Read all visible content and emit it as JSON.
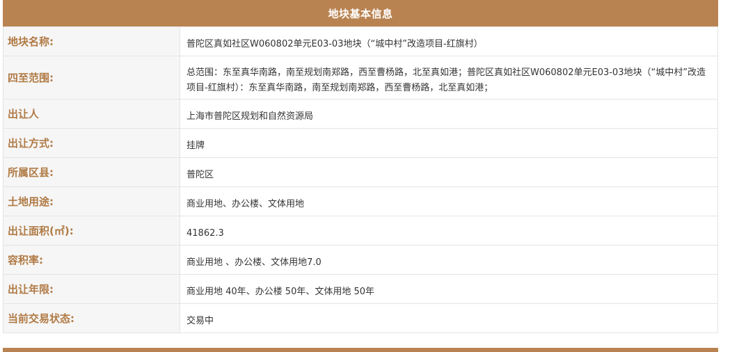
{
  "header": {
    "title": "地块基本信息"
  },
  "rows": [
    {
      "label": "地块名称:",
      "value": "普陀区真如社区W060802单元E03-03地块（“城中村”改造项目-红旗村）"
    },
    {
      "label": "四至范围:",
      "value": "总范围：东至真华南路，南至规划南郑路，西至曹杨路，北至真如港；普陀区真如社区W060802单元E03-03地块（“城中村”改造项目-红旗村）：东至真华南路，南至规划南郑路，西至曹杨路，北至真如港；"
    },
    {
      "label": "出让人",
      "value": "上海市普陀区规划和自然资源局"
    },
    {
      "label": "出让方式:",
      "value": "挂牌"
    },
    {
      "label": "所属区县:",
      "value": "普陀区"
    },
    {
      "label": "土地用途:",
      "value": "商业用地、办公楼、文体用地"
    },
    {
      "label": "出让面积(㎡):",
      "value": "41862.3"
    },
    {
      "label": "容积率:",
      "value": "商业用地 、办公楼、文体用地7.0"
    },
    {
      "label": "出让年限:",
      "value": "商业用地 40年、办公楼 50年、文体用地 50年"
    },
    {
      "label": "当前交易状态:",
      "value": "交易中"
    }
  ],
  "colors": {
    "accent": "#b98351",
    "label_text": "#b07a45",
    "label_bg": "#f6f6f6",
    "border": "#e4e4e4"
  }
}
